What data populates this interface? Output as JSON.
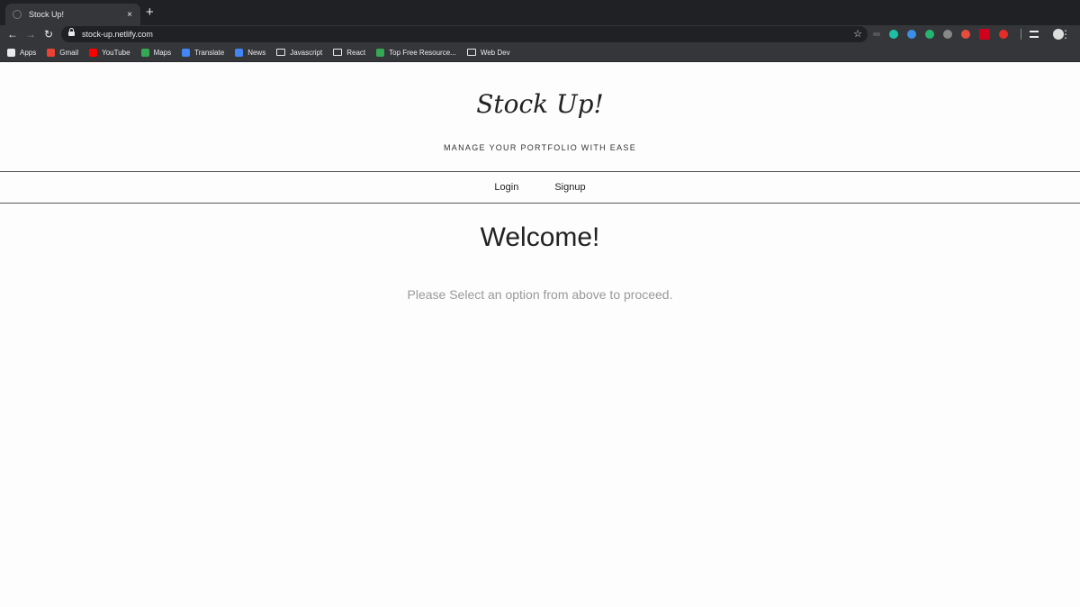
{
  "browser": {
    "tab_title": "Stock Up!",
    "tab_close": "×",
    "new_tab": "+",
    "url": "stock-up.netlify.com",
    "star": "☆",
    "menu": "⋮"
  },
  "bookmarks": [
    {
      "label": "Apps",
      "icon": "apps-grid-icon",
      "color": "#e8eaed"
    },
    {
      "label": "Gmail",
      "icon": "gmail-icon",
      "color": "#ea4335"
    },
    {
      "label": "YouTube",
      "icon": "youtube-icon",
      "color": "#ff0000"
    },
    {
      "label": "Maps",
      "icon": "maps-icon",
      "color": "#34a853"
    },
    {
      "label": "Translate",
      "icon": "translate-icon",
      "color": "#4285f4"
    },
    {
      "label": "News",
      "icon": "news-icon",
      "color": "#4285f4"
    },
    {
      "label": "Javascript",
      "icon": "folder-icon"
    },
    {
      "label": "React",
      "icon": "folder-icon"
    },
    {
      "label": "Top Free Resource...",
      "icon": "resource-icon",
      "color": "#34a853"
    },
    {
      "label": "Web Dev",
      "icon": "folder-icon"
    }
  ],
  "extensions": [
    "#1ec0a5",
    "#3a8ee6",
    "#26b56f",
    "#888888",
    "#e74c3c",
    "#d0021b",
    "#e52d27"
  ],
  "page": {
    "brand": "Stock Up!",
    "tagline": "MANAGE YOUR PORTFOLIO WITH EASE",
    "nav": {
      "login": "Login",
      "signup": "Signup"
    },
    "welcome": "Welcome!",
    "instruction": "Please Select an option from above to proceed."
  }
}
